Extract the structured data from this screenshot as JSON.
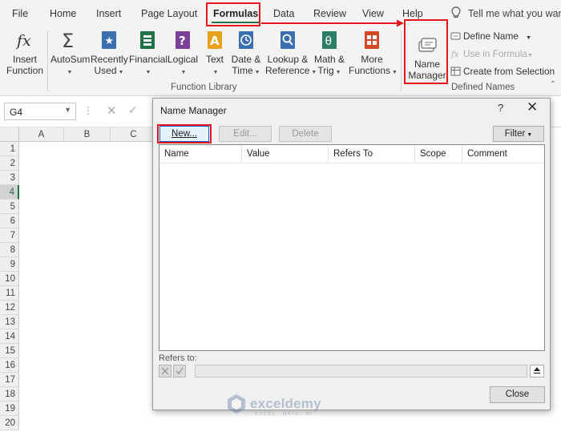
{
  "menu": {
    "tabs": [
      "File",
      "Home",
      "Insert",
      "Page Layout",
      "Formulas",
      "Data",
      "Review",
      "View",
      "Help"
    ],
    "active": "Formulas",
    "tell_me": "Tell me what you wan"
  },
  "ribbon": {
    "insert_function": [
      "Insert",
      "Function"
    ],
    "autosum": "AutoSum",
    "recently_used": [
      "Recently",
      "Used"
    ],
    "financial": "Financial",
    "logical": "Logical",
    "text": "Text",
    "date_time": [
      "Date &",
      "Time"
    ],
    "lookup_reference": [
      "Lookup &",
      "Reference"
    ],
    "math_trig": [
      "Math &",
      "Trig"
    ],
    "more_functions": [
      "More",
      "Functions"
    ],
    "function_library_label": "Function Library",
    "name_manager": [
      "Name",
      "Manager"
    ],
    "define_name": "Define Name",
    "use_in_formula": "Use in Formula",
    "create_from_selection": "Create from Selection",
    "defined_names_label": "Defined Names",
    "icon_colors": {
      "autosum": "#444444",
      "recently_used": "#3a6fb0",
      "financial": "#217346",
      "logical": "#7b3f98",
      "text": "#e8a21c",
      "date_time": "#3a6fb0",
      "lookup_reference": "#3a6fb0",
      "math_trig": "#2e7d67",
      "more_functions": "#d24726"
    }
  },
  "formula_bar": {
    "name_box": "G4"
  },
  "grid": {
    "columns": [
      "A",
      "B",
      "C"
    ],
    "rows": [
      "1",
      "2",
      "3",
      "4",
      "5",
      "6",
      "7",
      "8",
      "9",
      "10",
      "11",
      "12",
      "13",
      "14",
      "15",
      "16",
      "17",
      "18",
      "19",
      "20"
    ],
    "selected_row": "4"
  },
  "dialog": {
    "title": "Name Manager",
    "help": "?",
    "close_glyph": "✕",
    "new_button": "New...",
    "edit_button": "Edit...",
    "delete_button": "Delete",
    "filter_button": "Filter",
    "columns": [
      "Name",
      "Value",
      "Refers To",
      "Scope",
      "Comment"
    ],
    "refers_to_label": "Refers to:",
    "close_button": "Close"
  },
  "watermark": {
    "name": "exceldemy",
    "tagline": "EXCEL · DATA · BI"
  },
  "highlight_color": "#e8141b",
  "accent_color": "#217346"
}
